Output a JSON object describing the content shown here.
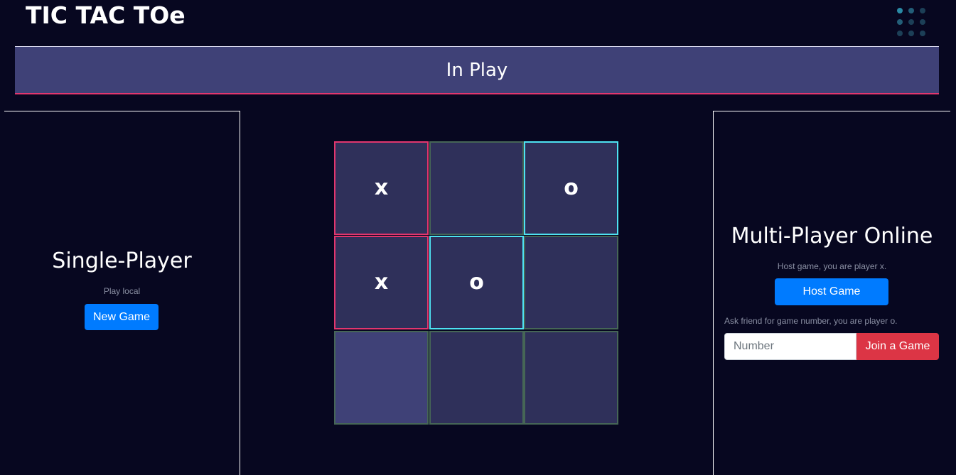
{
  "header": {
    "logo_text": "TIC TAC TOe",
    "menu_icon": "dots-grid-icon"
  },
  "status": {
    "text": "In Play"
  },
  "single_player": {
    "title": "Single-Player",
    "subtitle": "Play local",
    "new_game_label": "New Game"
  },
  "multi_player": {
    "title": "Multi-Player Online",
    "host_hint": "Host game, you are player x.",
    "host_label": "Host Game",
    "join_hint": "Ask friend for game number, you are player o.",
    "number_placeholder": "Number",
    "join_label": "Join a Game"
  },
  "board": {
    "cells": [
      "x",
      "",
      "o",
      "x",
      "o",
      "",
      "",
      "",
      ""
    ],
    "hovered_cell": 6
  },
  "colors": {
    "background": "#070720",
    "status_bar": "#3f4177",
    "cell": "#2f305a",
    "x_border": "#e2366e",
    "o_border": "#4ee3f2",
    "empty_border": "#466656",
    "primary_button": "#007bff",
    "danger_button": "#dc3545",
    "menu_dot_highlight": "#2a8aa5",
    "menu_dot": "#1c3f57"
  }
}
